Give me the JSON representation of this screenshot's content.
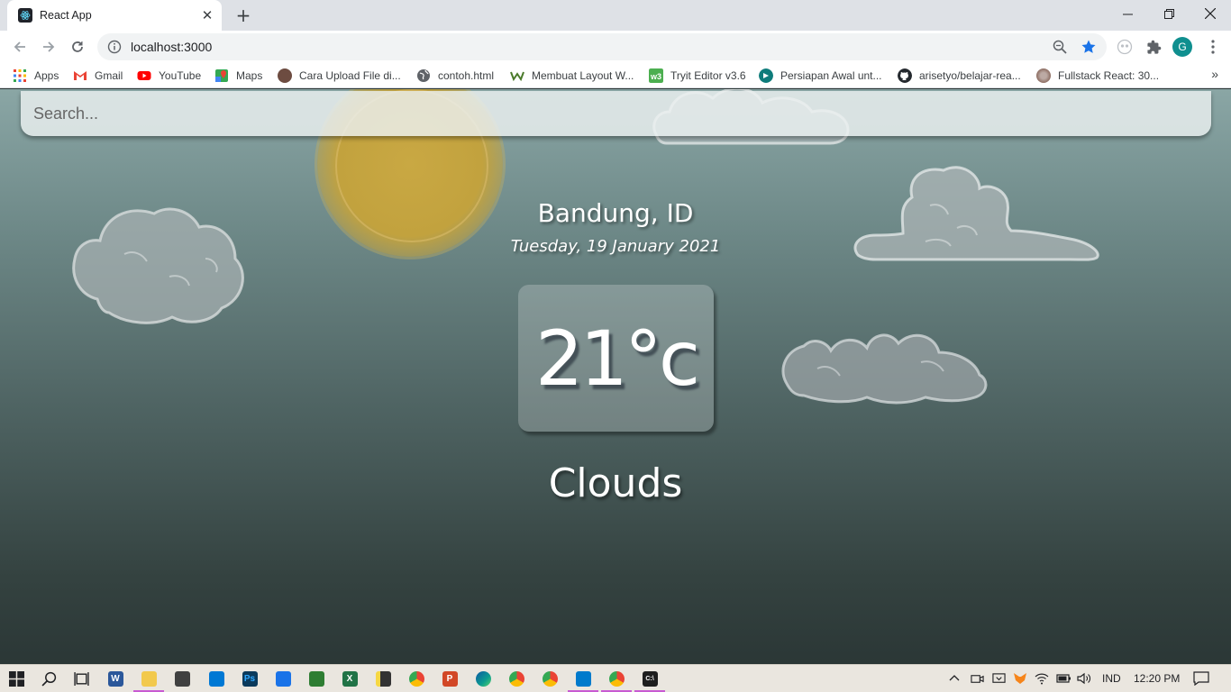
{
  "browser": {
    "tab_title": "React App",
    "url": "localhost:3000",
    "profile_initial": "G",
    "bookmarks": [
      {
        "label": "Apps",
        "icon": "apps-grid-icon",
        "color": "#ea4335"
      },
      {
        "label": "Gmail",
        "icon": "gmail-icon",
        "color": "#ea4335"
      },
      {
        "label": "YouTube",
        "icon": "youtube-icon",
        "color": "#ff0000"
      },
      {
        "label": "Maps",
        "icon": "maps-icon",
        "color": "#34a853"
      },
      {
        "label": "Cara Upload File di...",
        "icon": "avatar-icon",
        "color": "#6d4c41"
      },
      {
        "label": "contoh.html",
        "icon": "globe-icon",
        "color": "#5f6368"
      },
      {
        "label": "Membuat Layout W...",
        "icon": "w-logo-icon",
        "color": "#4a7a2a"
      },
      {
        "label": "Tryit Editor v3.6",
        "icon": "w3schools-icon",
        "color": "#4caf50"
      },
      {
        "label": "Persiapan Awal unt...",
        "icon": "dicoding-icon",
        "color": "#0e7c7b"
      },
      {
        "label": "arisetyo/belajar-rea...",
        "icon": "github-icon",
        "color": "#24292e"
      },
      {
        "label": "Fullstack React: 30...",
        "icon": "fullstack-icon",
        "color": "#8d6e63"
      }
    ]
  },
  "app": {
    "search_placeholder": "Search...",
    "location": "Bandung, ID",
    "date": "Tuesday, 19 January 2021",
    "temperature": "21°c",
    "condition": "Clouds"
  },
  "taskbar": {
    "language": "IND",
    "time": "12:20 PM",
    "apps": [
      {
        "name": "word",
        "label": "W",
        "color": "#2b579a"
      },
      {
        "name": "file-explorer",
        "label": "",
        "color": "#f2c94c"
      },
      {
        "name": "store",
        "label": "",
        "color": "#404040"
      },
      {
        "name": "mail",
        "label": "",
        "color": "#0078d4"
      },
      {
        "name": "photoshop",
        "label": "Ps",
        "color": "#0b3a5c"
      },
      {
        "name": "calendar",
        "label": "",
        "color": "#1a73e8"
      },
      {
        "name": "xampp",
        "label": "",
        "color": "#2e7d32"
      },
      {
        "name": "excel",
        "label": "X",
        "color": "#217346"
      },
      {
        "name": "sticky-notes",
        "label": "",
        "color": "#333333"
      },
      {
        "name": "chrome",
        "label": "",
        "color": "#fbbc05"
      },
      {
        "name": "powerpoint",
        "label": "P",
        "color": "#d24726"
      },
      {
        "name": "edge",
        "label": "",
        "color": "#0c9d8f"
      },
      {
        "name": "chrome-profile-2",
        "label": "",
        "color": "#ea4335"
      },
      {
        "name": "chrome-profile-3",
        "label": "",
        "color": "#34a853"
      },
      {
        "name": "vscode",
        "label": "",
        "color": "#007acc"
      },
      {
        "name": "chrome-active",
        "label": "",
        "color": "#ea4335"
      },
      {
        "name": "command-prompt",
        "label": "C:\\",
        "color": "#1e1e1e"
      }
    ]
  }
}
